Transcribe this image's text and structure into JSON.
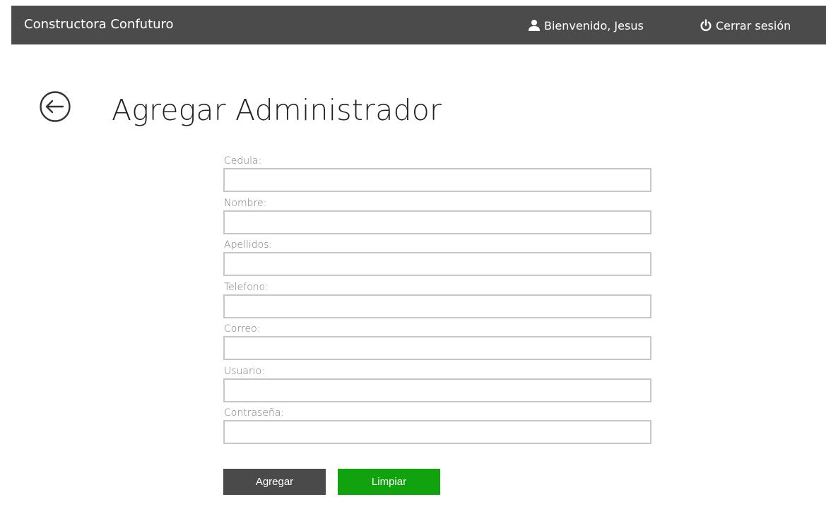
{
  "header": {
    "brand": "Constructora Confuturo",
    "welcome": "Bienvenido, Jesus",
    "logout": "Cerrar sesión",
    "user_icon": "user-icon",
    "logout_icon": "power-icon"
  },
  "page": {
    "title": "Agregar Administrador",
    "back_icon": "back-arrow-icon"
  },
  "form": {
    "fields": [
      {
        "label": "Cedula:",
        "value": ""
      },
      {
        "label": "Nombre:",
        "value": ""
      },
      {
        "label": "Apellidos:",
        "value": ""
      },
      {
        "label": "Telefono:",
        "value": ""
      },
      {
        "label": "Correo:",
        "value": ""
      },
      {
        "label": "Usuario:",
        "value": ""
      },
      {
        "label": "Contraseña:",
        "value": ""
      }
    ],
    "submit_label": "Agregar",
    "clear_label": "Limpiar"
  },
  "colors": {
    "topbar": "#4b4b4b",
    "submit_button": "#4a4a4a",
    "clear_button": "#10a30e",
    "input_border": "#c8c8c8"
  }
}
